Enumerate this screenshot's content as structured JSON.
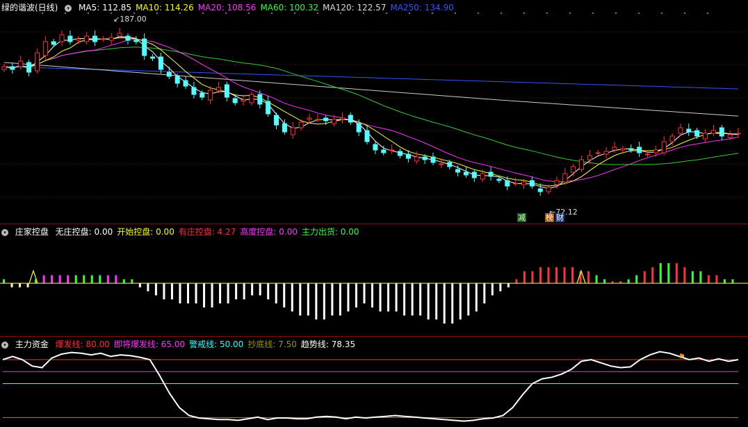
{
  "main": {
    "title": "绿的谐波(日线)",
    "ma_items": [
      {
        "label": "MA5: 112.85",
        "color": "#ffffff"
      },
      {
        "label": "MA10: 114.26",
        "color": "#ffff00"
      },
      {
        "label": "MA20: 108.56",
        "color": "#ff33ff"
      },
      {
        "label": "MA60: 100.32",
        "color": "#33ff33"
      },
      {
        "label": "MA120: 122.57",
        "color": "#dddddd"
      },
      {
        "label": "MA250: 134.90",
        "color": "#3355ff"
      }
    ],
    "high_label": "187.00",
    "low_label": "72.12",
    "markers": [
      "减",
      "榜",
      "财"
    ]
  },
  "control": {
    "title": "庄家控盘",
    "items": [
      {
        "label": "无庄控盘: 0.00",
        "color": "#ffffff"
      },
      {
        "label": "开始控盘: 0.00",
        "color": "#ffff00"
      },
      {
        "label": "有庄控盘: 4.27",
        "color": "#ff3333"
      },
      {
        "label": "高度控盘: 0.00",
        "color": "#ff33ff"
      },
      {
        "label": "主力出货: 0.00",
        "color": "#33ff33"
      }
    ]
  },
  "funds": {
    "title": "主力资金",
    "items": [
      {
        "label": "爆发线: 80.00",
        "color": "#ff3333"
      },
      {
        "label": "即将爆发线: 65.00",
        "color": "#ff33ff"
      },
      {
        "label": "警戒线: 50.00",
        "color": "#33ffff"
      },
      {
        "label": "抄底线: 7.50",
        "color": "#999900"
      },
      {
        "label": "趋势线: 78.35",
        "color": "#ffffff"
      }
    ],
    "levels": {
      "burst": 80,
      "soon": 65,
      "warn": 50,
      "bottom": 7.5
    },
    "trend": [
      80,
      84,
      80,
      72,
      70,
      82,
      87,
      89,
      88,
      86,
      88,
      84,
      86,
      85,
      83,
      80,
      60,
      38,
      20,
      10,
      7,
      6,
      5,
      5,
      4,
      6,
      8,
      5,
      7,
      7,
      6,
      6,
      8,
      9,
      8,
      6,
      8,
      7,
      8,
      9,
      10,
      9,
      8,
      7,
      6,
      5,
      4,
      3,
      4,
      6,
      7,
      10,
      20,
      36,
      50,
      56,
      58,
      62,
      68,
      78,
      80,
      76,
      72,
      70,
      71,
      80,
      86,
      90,
      88,
      84,
      80,
      82,
      78,
      81,
      78,
      80
    ]
  },
  "chart_data": [
    {
      "type": "candlestick",
      "title": "绿的谐波(日线)",
      "annotations": [
        "187.00",
        "72.12",
        "减",
        "榜",
        "财"
      ],
      "series_names": [
        "MA5",
        "MA10",
        "MA20",
        "MA60",
        "MA120",
        "MA250"
      ],
      "ma_last": {
        "MA5": 112.85,
        "MA10": 114.26,
        "MA20": 108.56,
        "MA60": 100.32,
        "MA120": 122.57,
        "MA250": 134.9
      },
      "close": [
        162,
        160,
        166,
        158,
        172,
        180,
        178,
        185,
        180,
        182,
        184,
        180,
        182,
        183,
        186,
        181,
        180,
        170,
        168,
        160,
        155,
        150,
        148,
        142,
        140,
        145,
        147,
        140,
        136,
        138,
        142,
        135,
        128,
        120,
        115,
        118,
        122,
        125,
        124,
        123,
        124,
        125,
        122,
        115,
        108,
        102,
        100,
        102,
        98,
        96,
        97,
        95,
        93,
        92,
        90,
        86,
        84,
        82,
        85,
        83,
        80,
        76,
        78,
        79,
        76,
        72,
        75,
        80,
        85,
        90,
        95,
        98,
        100,
        101,
        104,
        103,
        102,
        100,
        99,
        102,
        108,
        112,
        118,
        115,
        112,
        114,
        116,
        112,
        113,
        114
      ],
      "note": "close values are visual estimates (data units)"
    },
    {
      "type": "bar",
      "title": "庄家控盘",
      "series_names": [
        "无庄控盘",
        "开始控盘",
        "有庄控盘",
        "高度控盘",
        "主力出货"
      ],
      "values": [
        1,
        -1,
        -1,
        -1,
        1,
        2,
        2,
        2,
        2,
        2,
        2,
        2,
        2,
        2,
        2,
        1,
        1,
        -1,
        -2,
        -3,
        -4,
        -4,
        -5,
        -5,
        -5,
        -6,
        -6,
        -5,
        -5,
        -4,
        -4,
        -3,
        -3,
        -4,
        -5,
        -6,
        -7,
        -8,
        -8,
        -9,
        -9,
        -8,
        -8,
        -7,
        -6,
        -5,
        -6,
        -7,
        -7,
        -7,
        -8,
        -8,
        -8,
        -9,
        -9,
        -10,
        -10,
        -9,
        -8,
        -7,
        -5,
        -3,
        -2,
        -1,
        1,
        3,
        3,
        4,
        4,
        4,
        4,
        4,
        3,
        3,
        2,
        1,
        0.5,
        0.5,
        1,
        2,
        3,
        4,
        5,
        5,
        5,
        4,
        3,
        3,
        2,
        2,
        1,
        1
      ],
      "note": "relative bar heights, estimated"
    },
    {
      "type": "line",
      "title": "主力资金",
      "series_names": [
        "趋势线"
      ],
      "levels": {
        "爆发线": 80,
        "即将爆发线": 65,
        "警戒线": 50,
        "抄底线": 7.5
      }
    }
  ]
}
